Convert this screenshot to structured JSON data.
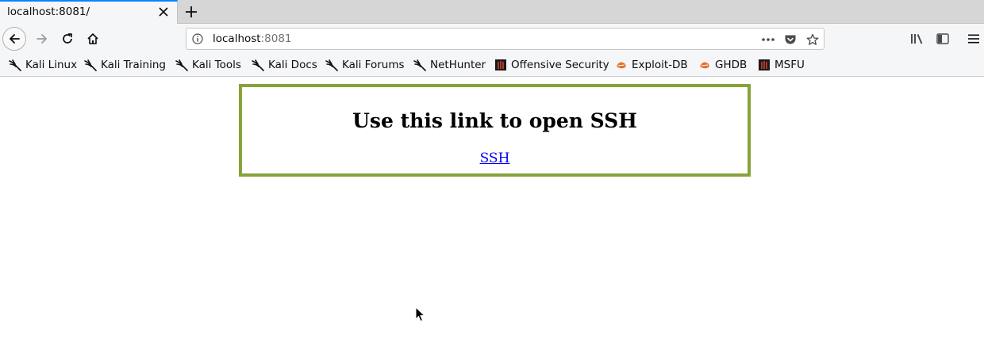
{
  "tab": {
    "title": "localhost:8081/"
  },
  "url": {
    "host": "localhost",
    "port": ":8081"
  },
  "bookmarks": [
    {
      "label": "Kali Linux",
      "icon": "kali-dragon-icon"
    },
    {
      "label": "Kali Training",
      "icon": "kali-dragon-icon"
    },
    {
      "label": "Kali Tools",
      "icon": "kali-dragon-icon"
    },
    {
      "label": "Kali Docs",
      "icon": "kali-dragon-icon"
    },
    {
      "label": "Kali Forums",
      "icon": "kali-dragon-icon"
    },
    {
      "label": "NetHunter",
      "icon": "kali-dragon-icon"
    },
    {
      "label": "Offensive Security",
      "icon": "offsec-icon"
    },
    {
      "label": "Exploit-DB",
      "icon": "exploitdb-icon"
    },
    {
      "label": "GHDB",
      "icon": "exploitdb-icon"
    },
    {
      "label": "MSFU",
      "icon": "offsec-icon"
    }
  ],
  "page": {
    "heading": "Use this link to open SSH",
    "link_label": "SSH"
  },
  "colors": {
    "card_border": "#86a33a",
    "link": "#0000ee",
    "tab_accent": "#0a84ff"
  }
}
